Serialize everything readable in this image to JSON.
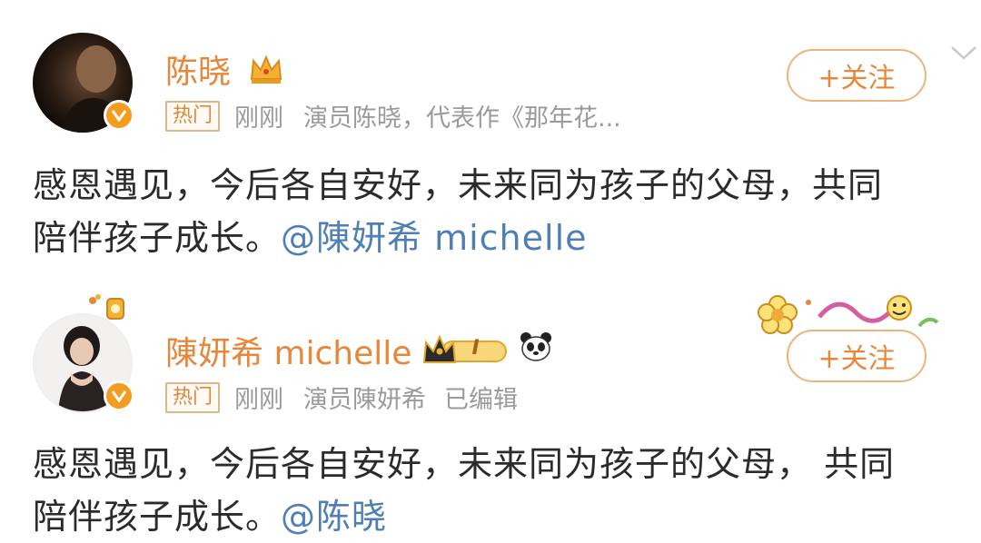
{
  "posts": [
    {
      "author": "陈晓",
      "badge": "热门",
      "time": "刚刚",
      "source": "演员陈晓，代表作《那年花...",
      "follow_label": "+关注",
      "content_line1": "感恩遇见，今后各自安好，未来同为孩子的父母，共同",
      "content_line2": "陪伴孩子成长。",
      "mention": "@陳妍希 michelle"
    },
    {
      "author": "陳妍希 michelle",
      "level_badge": "I",
      "badge": "热门",
      "time": "刚刚",
      "source": "演员陳妍希",
      "edited": "已编辑",
      "follow_label": "+关注",
      "content_line1": "感恩遇见，今后各自安好，未来同为孩子的父母， 共同",
      "content_line2": "陪伴孩子成长。",
      "mention": "@陈晓"
    }
  ],
  "icons": [
    "crown-icon",
    "verified-icon",
    "chevron-down-icon",
    "panda-icon",
    "flower-decoration-icon"
  ],
  "colors": {
    "name": "#e8863a",
    "mention": "#4f7fb5",
    "meta": "#9a9a9a",
    "verified": "#f39c1f"
  }
}
